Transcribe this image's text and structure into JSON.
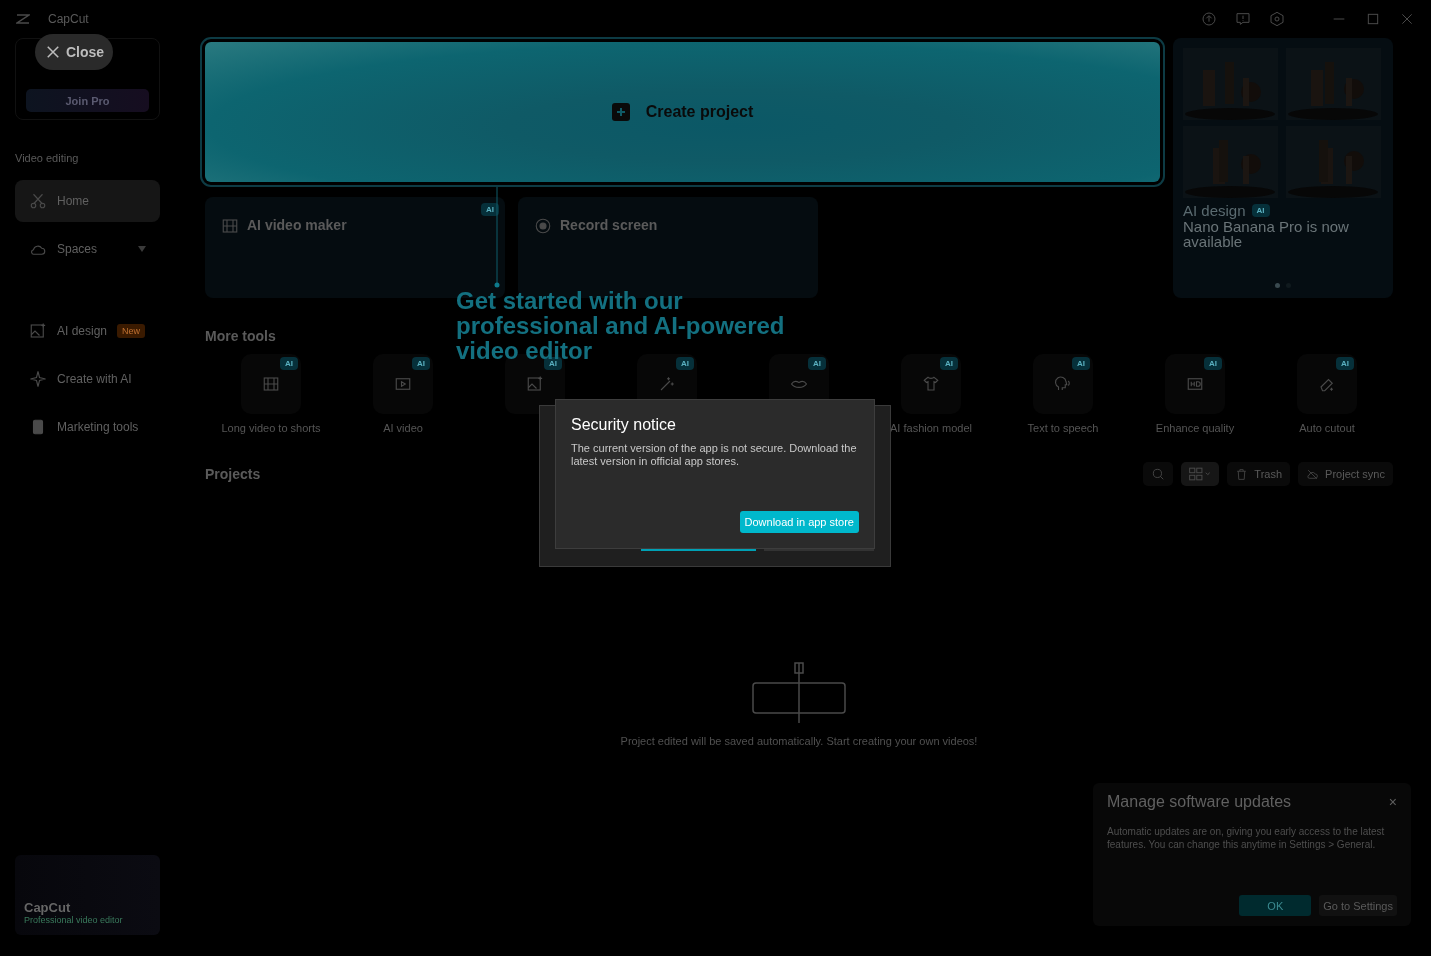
{
  "app": {
    "logo": "CapCut"
  },
  "tour": {
    "close": "Close",
    "text": "Get started with our professional and AI-powered video editor"
  },
  "sidebar": {
    "join": "Join Pro",
    "section": "Video editing",
    "items": [
      {
        "label": "Home",
        "selected": true
      },
      {
        "label": "Spaces",
        "selected": false
      },
      {
        "label": "AI design",
        "selected": false,
        "badge": "New"
      },
      {
        "label": "Create with AI",
        "selected": false
      },
      {
        "label": "Marketing tools",
        "selected": false
      }
    ],
    "promo": {
      "title": "CapCut",
      "subtitle": "Professional video editor"
    }
  },
  "create": {
    "label": "Create project"
  },
  "cards": [
    {
      "label": "AI video maker",
      "badge": "AI"
    },
    {
      "label": "Record screen"
    }
  ],
  "banner": {
    "title": "AI design",
    "badge": "AI",
    "headline": "Nano Banana Pro is now available",
    "dots": [
      {
        "selected": true
      },
      {
        "selected": false
      }
    ]
  },
  "more_tools": {
    "title": "More tools",
    "tools": [
      {
        "label": "Long video to shorts",
        "badge": "AI"
      },
      {
        "label": "AI video",
        "badge": "AI"
      },
      {
        "badge": "AI"
      },
      {
        "badge": "AI"
      },
      {
        "badge": "AI"
      },
      {
        "label": "AI fashion model",
        "badge": "AI"
      },
      {
        "label": "Text to speech",
        "badge": "AI"
      },
      {
        "label": "Enhance quality",
        "badge": "AI"
      },
      {
        "label": "Auto cutout",
        "badge": "AI"
      }
    ]
  },
  "projects": {
    "title": "Projects",
    "grid_view": {
      "selected": true
    },
    "trash": "Trash",
    "sync": "Project sync",
    "empty": "Project edited will be saved automatically. Start creating your own videos!"
  },
  "security": {
    "title": "Security notice",
    "body": "The current version of the app is not secure. Download the latest version in official app stores.",
    "button": "Download in app store"
  },
  "updates": {
    "title": "Manage software updates",
    "close": "×",
    "body": "Automatic updates are on, giving you early access to the latest features. You can change this anytime in Settings > General.",
    "ok": "OK",
    "settings": "Go to Settings"
  }
}
